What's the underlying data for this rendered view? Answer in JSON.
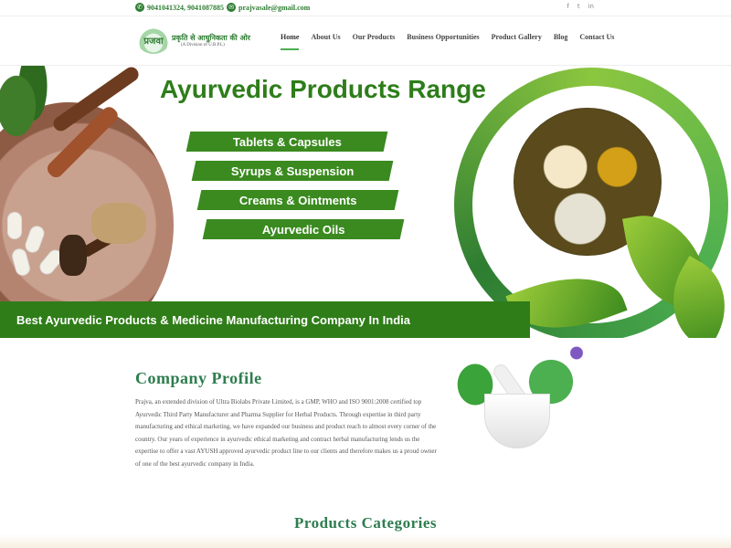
{
  "topbar": {
    "phone": "9041041324, 9041087885",
    "email": "prajvasale@gmail.com",
    "phone_icon": "phone-icon",
    "email_icon": "email-icon",
    "social": [
      {
        "icon": "facebook-icon",
        "glyph": "f"
      },
      {
        "icon": "twitter-icon",
        "glyph": "t"
      },
      {
        "icon": "linkedin-icon",
        "glyph": "in"
      }
    ]
  },
  "header": {
    "logo_mark": "प्रजवा",
    "logo_tagline": "प्रकृति से आधुनिकता की ओर",
    "logo_sub": "(A Division of U.B.P.L)",
    "nav": [
      {
        "label": "Home",
        "active": true
      },
      {
        "label": "About Us"
      },
      {
        "label": "Our Products"
      },
      {
        "label": "Business Opportunities"
      },
      {
        "label": "Product Gallery"
      },
      {
        "label": "Blog"
      },
      {
        "label": "Contact Us"
      }
    ]
  },
  "banner": {
    "title": "Ayurvedic Products Range",
    "items": [
      "Tablets & Capsules",
      "Syrups & Suspension",
      "Creams & Ointments",
      "Ayurvedic Oils"
    ],
    "strip": "Best Ayurvedic Products & Medicine Manufacturing Company In India",
    "colors": {
      "green": "#3a8a1f",
      "dark_green": "#2f7d18",
      "title_green": "#2e7d1a"
    }
  },
  "profile": {
    "title": "Company Profile",
    "text": "Prajva, an extended division of Ultra Biolabs Private Limited, is a GMP, WHO and ISO 9001:2008 certified top Ayurvedic Third Party Manufacturer and Pharma Supplier for Herbal Products. Through expertise in third party manufacturing and ethical marketing, we have expanded our business and product reach to almost every corner of the country. Our years of experience in ayurvedic ethical marketing and contract herbal manufacturing lends us the expertise to offer a vast AYUSH approved ayurvedic product line to our clients and therefore makes us a proud owner of one of the best ayurvedic company in India."
  },
  "categories": {
    "title": "Products Categories"
  }
}
